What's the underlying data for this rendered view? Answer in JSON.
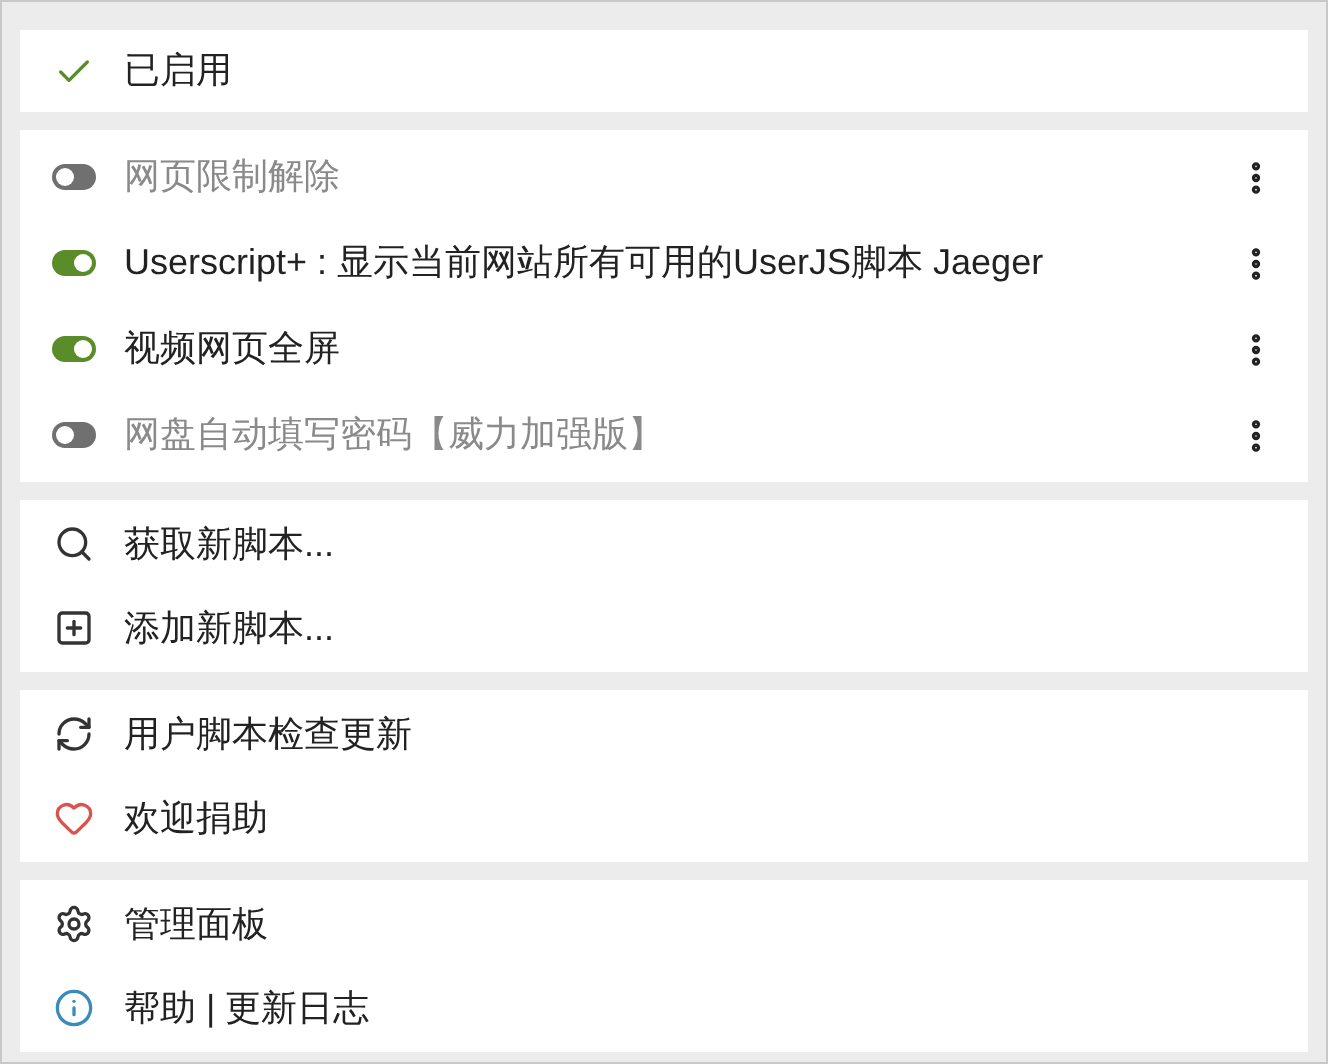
{
  "status": {
    "label": "已启用",
    "checked": true
  },
  "scripts": [
    {
      "name": "网页限制解除",
      "enabled": false
    },
    {
      "name": "Userscript+ : 显示当前网站所有可用的UserJS脚本 Jaeger",
      "enabled": true
    },
    {
      "name": "视频网页全屏",
      "enabled": true
    },
    {
      "name": "网盘自动填写密码【威力加强版】",
      "enabled": false
    }
  ],
  "action_groups": [
    [
      {
        "kind": "search",
        "label": "获取新脚本..."
      },
      {
        "kind": "add",
        "label": "添加新脚本..."
      }
    ],
    [
      {
        "kind": "refresh",
        "label": "用户脚本检查更新"
      },
      {
        "kind": "heart",
        "label": "欢迎捐助"
      }
    ],
    [
      {
        "kind": "settings",
        "label": "管理面板"
      },
      {
        "kind": "info",
        "label": "帮助 | 更新日志"
      }
    ]
  ]
}
